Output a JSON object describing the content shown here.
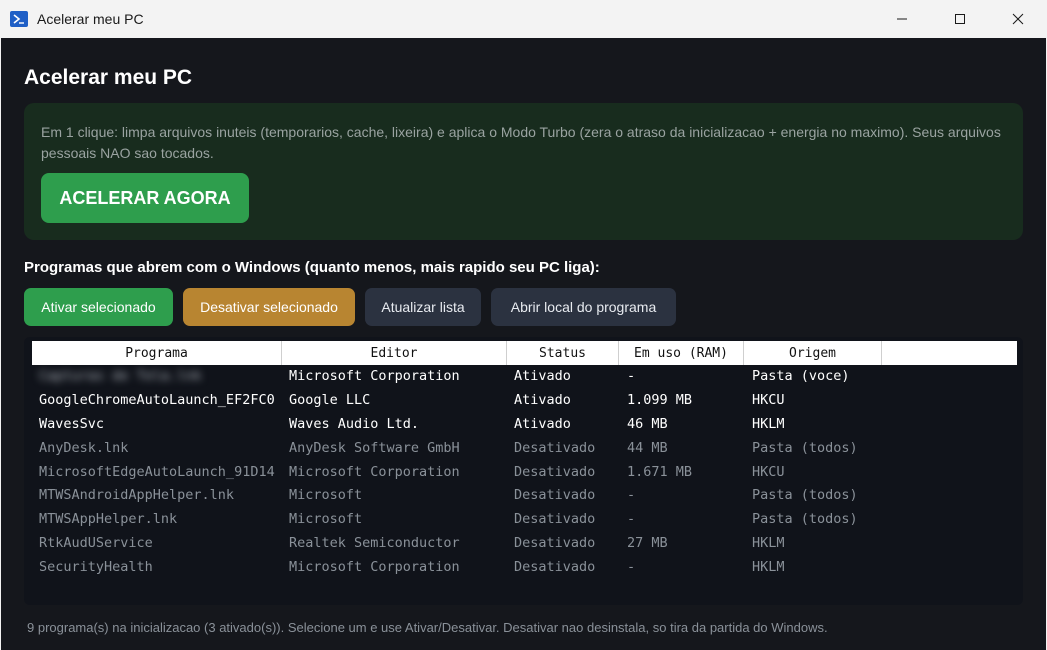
{
  "window": {
    "title": "Acelerar meu PC"
  },
  "page": {
    "heading": "Acelerar meu PC",
    "hero": {
      "description": "Em 1 clique: limpa arquivos inuteis (temporarios, cache, lixeira) e aplica o Modo Turbo (zera o atraso da inicializacao + energia no maximo). Seus arquivos pessoais NAO sao tocados.",
      "button_label": "ACELERAR AGORA"
    },
    "section_label": "Programas que abrem com o Windows (quanto menos, mais rapido seu PC liga):",
    "actions": {
      "enable_label": "Ativar selecionado",
      "disable_label": "Desativar selecionado",
      "refresh_label": "Atualizar lista",
      "open_location_label": "Abrir local do programa"
    },
    "table": {
      "columns": [
        "Programa",
        "Editor",
        "Status",
        "Em uso (RAM)",
        "Origem"
      ],
      "rows": [
        {
          "program": "Capturas de Tela.lnk",
          "publisher": "Microsoft Corporation",
          "status": "Ativado",
          "ram": "-",
          "origin": "Pasta (voce)"
        },
        {
          "program": "GoogleChromeAutoLaunch_EF2FC0",
          "publisher": "Google LLC",
          "status": "Ativado",
          "ram": "1.099 MB",
          "origin": "HKCU"
        },
        {
          "program": "WavesSvc",
          "publisher": "Waves Audio Ltd.",
          "status": "Ativado",
          "ram": "46 MB",
          "origin": "HKLM"
        },
        {
          "program": "AnyDesk.lnk",
          "publisher": "AnyDesk Software GmbH",
          "status": "Desativado",
          "ram": "44 MB",
          "origin": "Pasta (todos)"
        },
        {
          "program": "MicrosoftEdgeAutoLaunch_91D14",
          "publisher": "Microsoft Corporation",
          "status": "Desativado",
          "ram": "1.671 MB",
          "origin": "HKCU"
        },
        {
          "program": "MTWSAndroidAppHelper.lnk",
          "publisher": "Microsoft",
          "status": "Desativado",
          "ram": "-",
          "origin": "Pasta (todos)"
        },
        {
          "program": "MTWSAppHelper.lnk",
          "publisher": "Microsoft",
          "status": "Desativado",
          "ram": "-",
          "origin": "Pasta (todos)"
        },
        {
          "program": "RtkAudUService",
          "publisher": "Realtek Semiconductor",
          "status": "Desativado",
          "ram": "27 MB",
          "origin": "HKLM"
        },
        {
          "program": "SecurityHealth",
          "publisher": "Microsoft Corporation",
          "status": "Desativado",
          "ram": "-",
          "origin": "HKLM"
        }
      ]
    },
    "footer": "9 programa(s) na inicializacao (3 ativado(s)). Selecione um e use Ativar/Desativar. Desativar nao desinstala, so tira da partida do Windows."
  },
  "colors": {
    "background": "#15171c",
    "hero_background": "#182c1e",
    "accent_green": "#2e9e4d",
    "accent_amber": "#b88531",
    "neutral_button": "#2b3240"
  },
  "icons": [
    "powershell-app-icon",
    "minimize-icon",
    "maximize-icon",
    "close-icon"
  ]
}
